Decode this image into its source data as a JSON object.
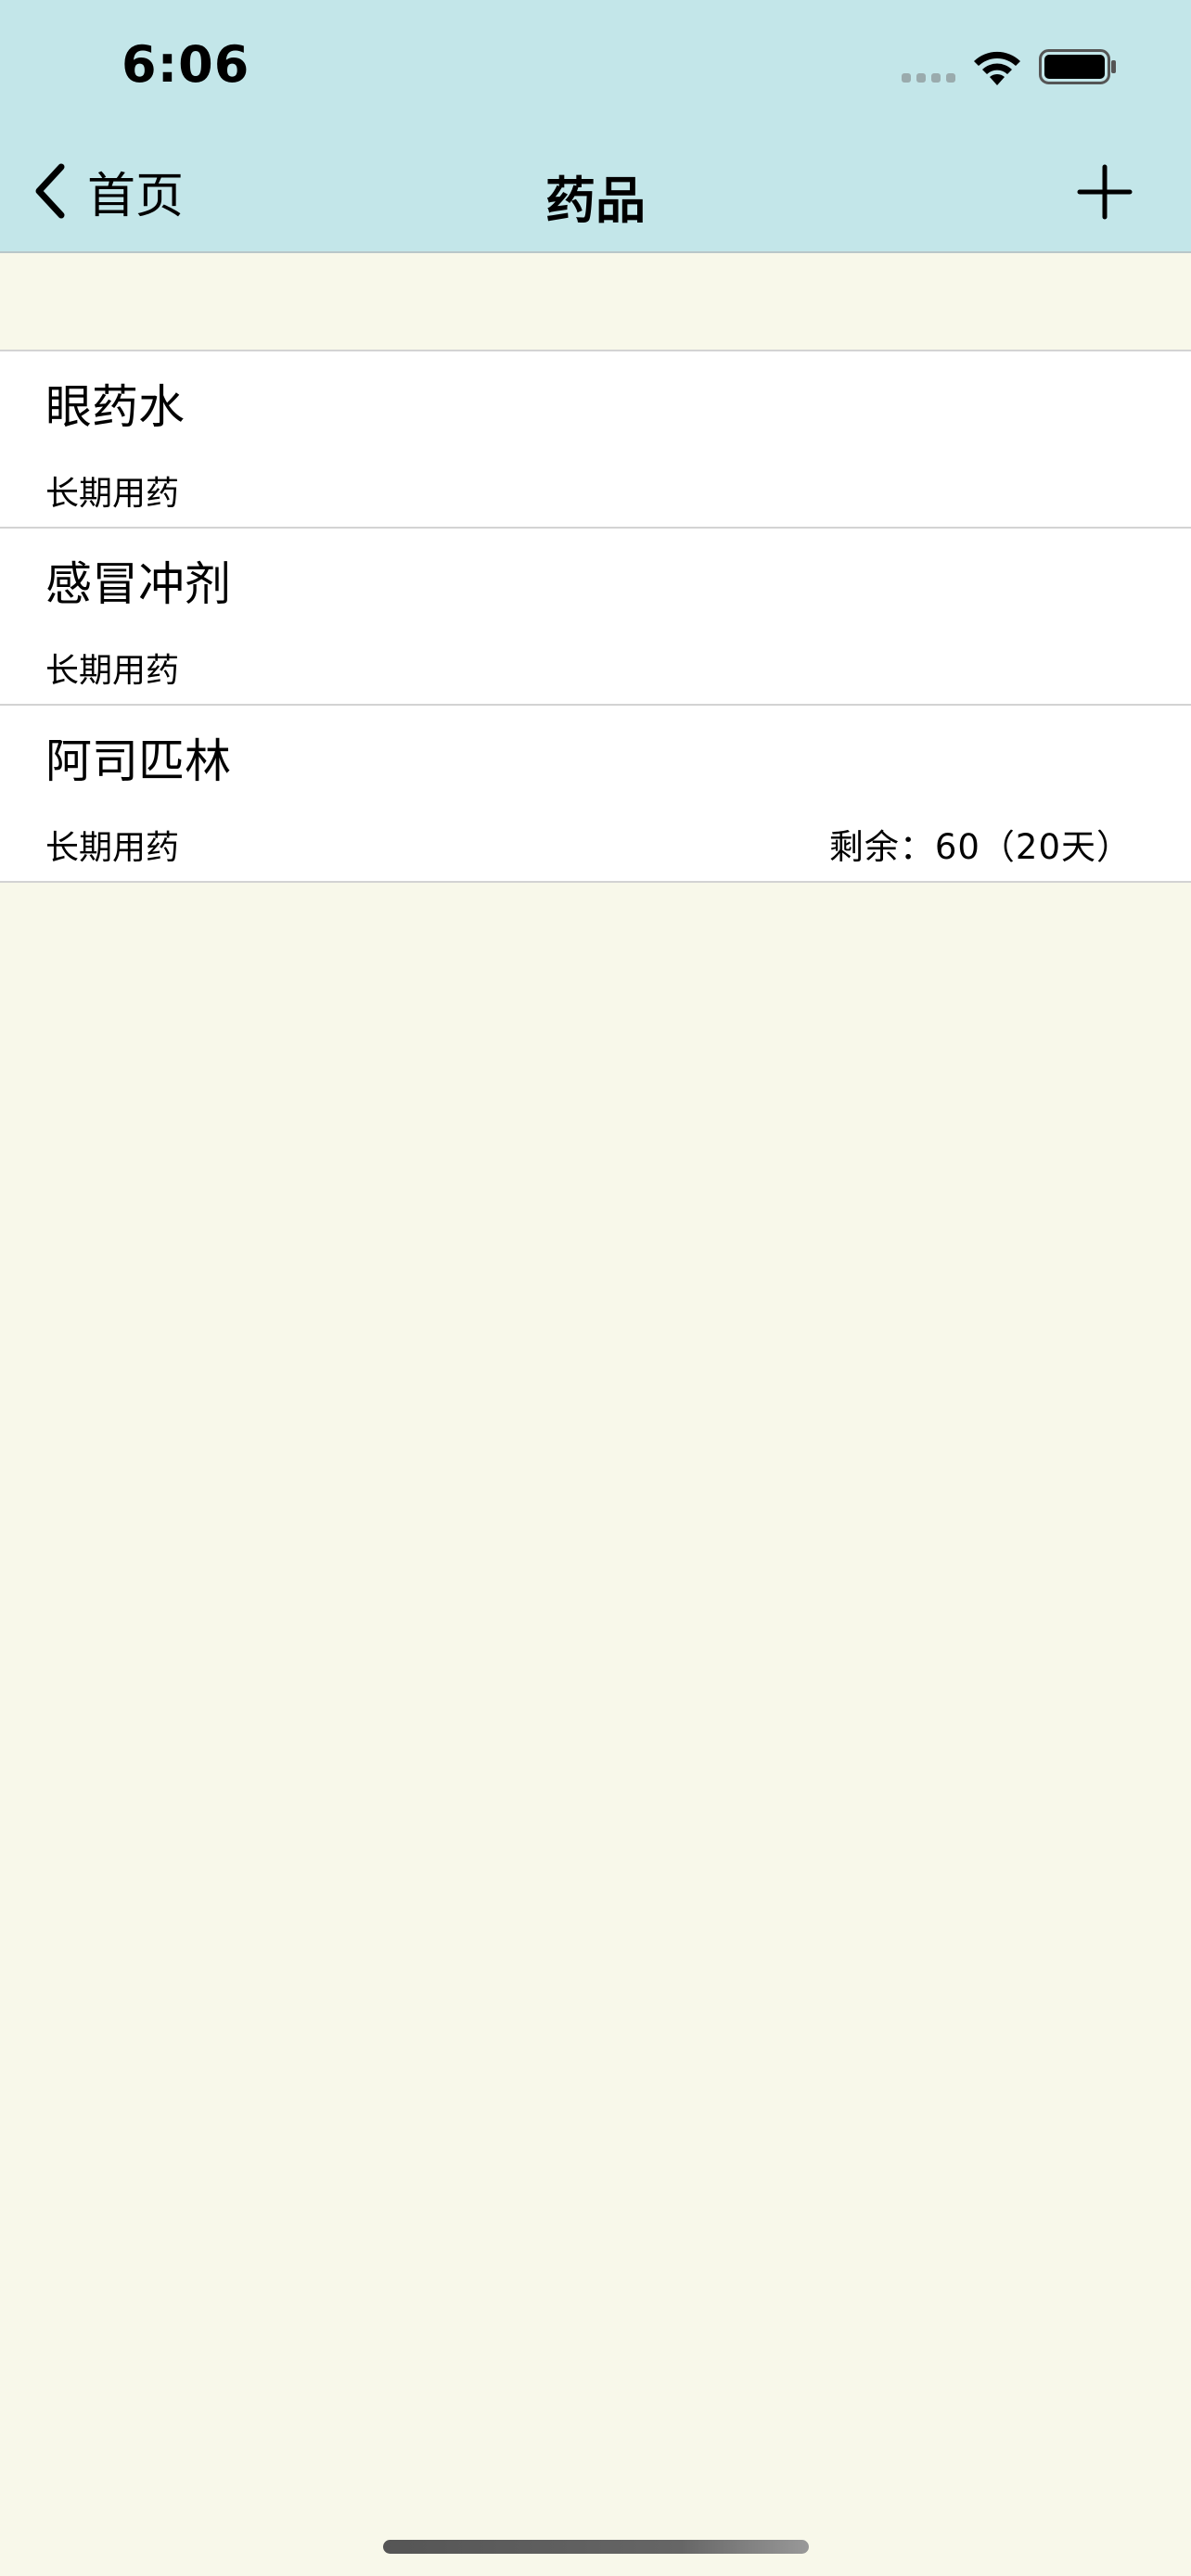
{
  "status_bar": {
    "time": "6:06"
  },
  "nav": {
    "back_label": "首页",
    "title": "药品",
    "back_icon": "chevron-left-icon",
    "add_icon": "plus-icon"
  },
  "medicines": [
    {
      "name": "眼药水",
      "tag": "长期用药",
      "remaining": ""
    },
    {
      "name": "感冒冲剂",
      "tag": "长期用药",
      "remaining": ""
    },
    {
      "name": "阿司匹林",
      "tag": "长期用药",
      "remaining": "剩余：60（20天）"
    }
  ],
  "colors": {
    "header_bg": "#c3e6e9",
    "page_bg": "#f8f8ea",
    "row_bg": "#ffffff"
  }
}
